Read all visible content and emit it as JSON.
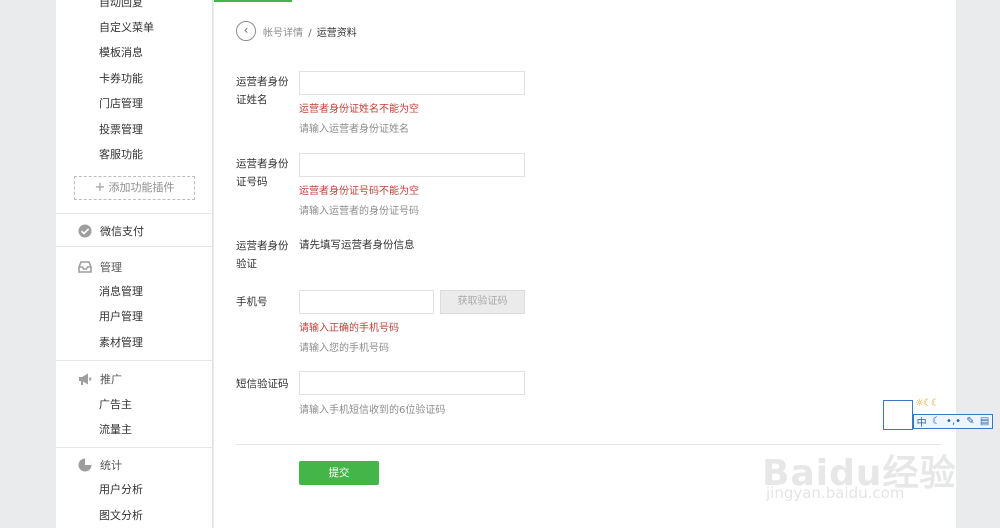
{
  "sidebar": {
    "plugin_items": [
      "自动回复",
      "自定义菜单",
      "模板消息",
      "卡券功能",
      "门店管理",
      "投票管理",
      "客服功能"
    ],
    "add_plugin": "添加功能插件",
    "wechat_pay": "微信支付",
    "manage": {
      "title": "管理",
      "items": [
        "消息管理",
        "用户管理",
        "素材管理"
      ]
    },
    "promote": {
      "title": "推广",
      "items": [
        "广告主",
        "流量主"
      ]
    },
    "stats": {
      "title": "统计",
      "items": [
        "用户分析",
        "图文分析"
      ]
    }
  },
  "breadcrumb": {
    "parent": "帐号详情",
    "separator": "/",
    "current": "运营资料"
  },
  "form": {
    "id_name": {
      "label": "运营者身份证姓名",
      "value": "",
      "error": "运营者身份证姓名不能为空",
      "hint": "请输入运营者身份证姓名"
    },
    "id_number": {
      "label": "运营者身份证号码",
      "value": "",
      "error": "运营者身份证号码不能为空",
      "hint": "请输入运营者的身份证号码"
    },
    "id_verify": {
      "label": "运营者身份验证",
      "value": "请先填写运营者身份信息"
    },
    "phone": {
      "label": "手机号",
      "value": "",
      "button": "获取验证码",
      "error": "请输入正确的手机号码",
      "hint": "请输入您的手机号码"
    },
    "sms_code": {
      "label": "短信验证码",
      "value": "",
      "hint": "请输入手机短信收到的6位验证码"
    },
    "submit": "提交"
  },
  "ime_toolbar": {
    "mode": "中",
    "extra": "•,•"
  },
  "watermark": {
    "brand": "Baidu经验",
    "url": "jingyan.baidu.com"
  },
  "colors": {
    "accent": "#44b549",
    "error": "#c0413a",
    "hint": "#8d8d8d"
  }
}
